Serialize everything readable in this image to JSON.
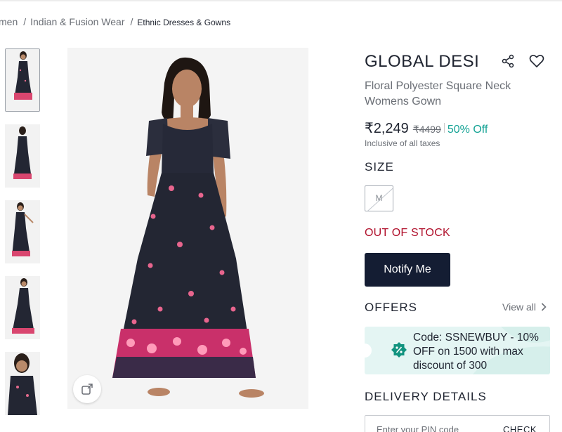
{
  "breadcrumb": {
    "items": [
      "men",
      "Indian & Fusion Wear",
      "Ethnic Dresses & Gowns"
    ]
  },
  "gallery": {
    "thumbnail_count": 5,
    "active_index": 0,
    "zoom_icon": "expand-icon"
  },
  "product": {
    "brand": "GLOBAL DESI",
    "name": "Floral Polyester Square Neck Womens Gown",
    "price": "₹2,249",
    "mrp": "₹4499",
    "discount": "50% Off",
    "tax_note": "Inclusive of all taxes"
  },
  "actions": {
    "share_icon": "share-icon",
    "wishlist_icon": "heart-icon"
  },
  "size": {
    "title": "SIZE",
    "options": [
      "M"
    ],
    "unavailable": [
      "M"
    ]
  },
  "stock": {
    "status": "OUT OF STOCK",
    "notify_label": "Notify Me"
  },
  "offers": {
    "title": "OFFERS",
    "view_all_label": "View all",
    "items": [
      {
        "text": "Code: SSNEWBUY - 10% OFF on 1500 with max discount of 300",
        "icon": "percent-badge-icon"
      }
    ]
  },
  "delivery": {
    "title": "DELIVERY DETAILS",
    "pin_placeholder": "Enter your PIN code",
    "check_label": "CHECK"
  },
  "colors": {
    "accent_dark": "#141d33",
    "discount_green": "#15a395",
    "out_of_stock_red": "#b0102b",
    "offer_bg": "#e4f5f3"
  }
}
